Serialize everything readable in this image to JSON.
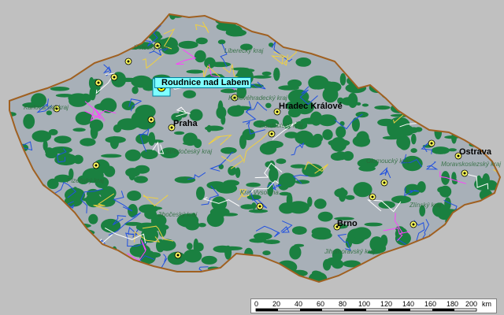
{
  "map": {
    "selected_city": "Roudnice nad Labem",
    "cities": [
      {
        "name": "Praha"
      },
      {
        "name": "Hradec Králové"
      },
      {
        "name": "Ostrava"
      },
      {
        "name": "Brno"
      }
    ],
    "regions": [
      "Ústecký kraj",
      "Liberecký kraj",
      "Královéhradecký kraj",
      "Pardubický kraj",
      "Karlovarský kraj",
      "Plzeňský kraj",
      "Středočeský kraj",
      "Jihočeský kraj",
      "Kraj Vysočina",
      "Jihomoravský kraj",
      "Zlínský kraj",
      "Olomoucký kraj",
      "Moravskoslezský kraj"
    ],
    "colors": {
      "background": "#c0c0c0",
      "land": "#a8b0b8",
      "forest": "#1a8040",
      "border": "#a06020",
      "rivers": "#2050e0",
      "roads": "#f0d040",
      "highlight": "#7fffff"
    }
  },
  "scale": {
    "ticks": [
      "0",
      "20",
      "40",
      "60",
      "80",
      "100",
      "120",
      "140",
      "160",
      "180",
      "200"
    ],
    "unit": "km"
  }
}
